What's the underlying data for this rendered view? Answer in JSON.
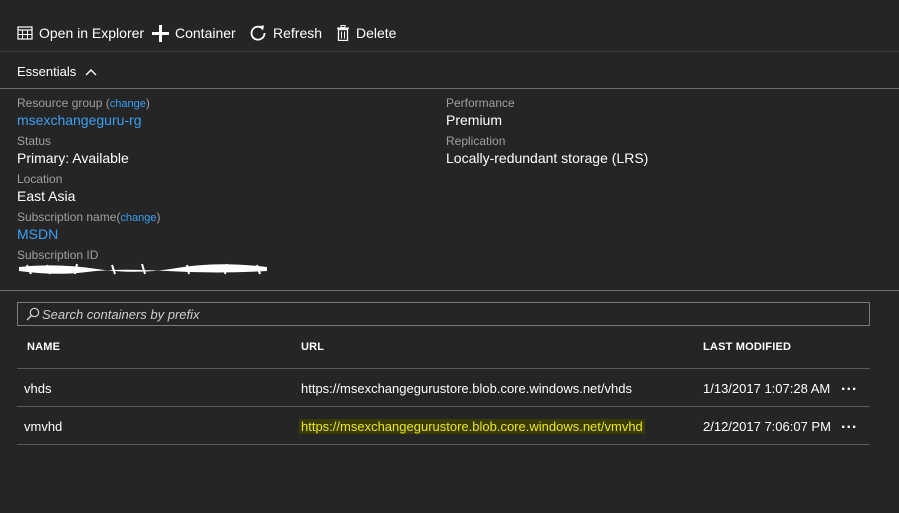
{
  "toolbar": {
    "open_in_explorer": "Open in Explorer",
    "container": "Container",
    "refresh": "Refresh",
    "delete": "Delete"
  },
  "essentials": {
    "title": "Essentials",
    "change_link": "change",
    "resource_group_label": "Resource group",
    "resource_group_value": "msexchangeguru-rg",
    "status_label": "Status",
    "status_value": "Primary: Available",
    "location_label": "Location",
    "location_value": "East Asia",
    "subscription_name_label": "Subscription name",
    "subscription_name_value": "MSDN",
    "subscription_id_label": "Subscription ID",
    "performance_label": "Performance",
    "performance_value": "Premium",
    "replication_label": "Replication",
    "replication_value": "Locally-redundant storage (LRS)"
  },
  "search": {
    "placeholder": "Search containers by prefix"
  },
  "table": {
    "headers": {
      "name": "NAME",
      "url": "URL",
      "last_modified": "LAST MODIFIED"
    },
    "rows": [
      {
        "name": "vhds",
        "url": "https://msexchangegurustore.blob.core.windows.net/vhds",
        "last_modified": "1/13/2017 1:07:28 AM",
        "more": "..."
      },
      {
        "name": "vmvhd",
        "url": "https://msexchangegurustore.blob.core.windows.net/vmvhd",
        "last_modified": "2/12/2017 7:06:07 PM",
        "more": "..."
      }
    ]
  },
  "colors": {
    "background": "#252526",
    "link": "#3aa0f3",
    "highlight_text": "#e6e61e",
    "highlight_bg": "#3b3b08"
  },
  "icons": [
    "open-in-explorer-icon",
    "plus-icon",
    "refresh-icon",
    "trash-icon",
    "chevron-up-icon",
    "search-icon"
  ]
}
